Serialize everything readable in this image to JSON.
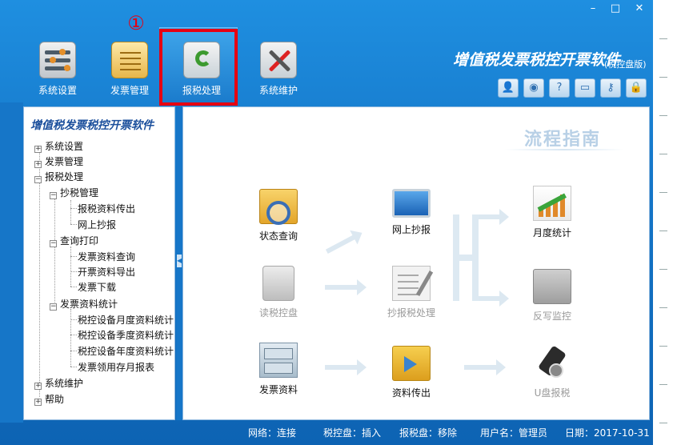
{
  "window": {
    "min_glyph": "–",
    "max_glyph": "□",
    "close_glyph": "✕"
  },
  "annotation": {
    "marker": "①"
  },
  "toolbar": {
    "items": [
      {
        "label": "系统设置",
        "icon": "settings-icon"
      },
      {
        "label": "发票管理",
        "icon": "invoice-icon"
      },
      {
        "label": "报税处理",
        "icon": "tax-report-icon"
      },
      {
        "label": "系统维护",
        "icon": "maintenance-icon"
      }
    ]
  },
  "app": {
    "title": "增值税发票税控开票软件",
    "subtitle": "(税控盘版)"
  },
  "quick_buttons": [
    {
      "icon": "user-icon",
      "glyph": "👤"
    },
    {
      "icon": "globe-icon",
      "glyph": "◉"
    },
    {
      "icon": "help-icon",
      "glyph": "?"
    },
    {
      "icon": "window-icon",
      "glyph": "▭"
    },
    {
      "icon": "key-icon",
      "glyph": "⚷"
    },
    {
      "icon": "lock-icon",
      "glyph": "🔒"
    }
  ],
  "tree": {
    "title": "增值税发票税控开票软件",
    "nodes": {
      "system_settings": "系统设置",
      "invoice_mgmt": "发票管理",
      "tax_processing": "报税处理",
      "copy_tax_mgmt": "抄税管理",
      "tax_data_export": "报税资料传出",
      "online_copy": "网上抄报",
      "query_print": "查询打印",
      "invoice_query": "发票资料查询",
      "issue_export": "开票资料导出",
      "invoice_download": "发票下载",
      "invoice_stats": "发票资料统计",
      "monthly_stats": "税控设备月度资料统计",
      "quarterly_stats": "税控设备季度资料统计",
      "yearly_stats": "税控设备年度资料统计",
      "stock_report": "发票领用存月报表",
      "system_maint": "系统维护",
      "help": "帮助"
    },
    "expand_glyph": "+",
    "collapse_glyph": "−"
  },
  "guide": {
    "title": "流程指南",
    "steps": {
      "status_query": "状态查询",
      "online_copy": "网上抄报",
      "monthly_stats": "月度统计",
      "read_tax_disk": "读税控盘",
      "copy_tax_process": "抄报税处理",
      "writeback_monitor": "反写监控",
      "invoice_data": "发票资料",
      "data_export": "资料传出",
      "ukey_report": "U盘报税"
    }
  },
  "status_bar": {
    "network": "网络：连接",
    "tax_disk": "税控盘：插入",
    "report_disk": "报税盘：移除",
    "username": "用户名：管理员",
    "date": "日期：2017-10-31"
  },
  "colors": {
    "window_blue": "#1577c9",
    "highlight_red": "#e60012",
    "tree_title_blue": "#1b4f9c",
    "guide_title": "#b8d0e6"
  }
}
